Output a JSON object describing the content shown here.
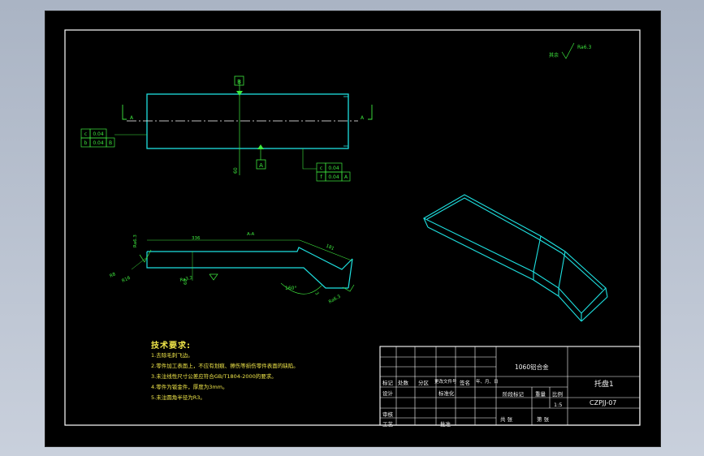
{
  "colors": {
    "outline": "#1ee0e0",
    "dimension": "#3ee83e",
    "text": "#f0e64a",
    "frame": "#ffffff",
    "background": "#000000"
  },
  "front_view": {
    "datum_top": "B",
    "datum_bottom": "A",
    "dim_vertical": "60",
    "section_left": "A",
    "section_right": "A",
    "fcf_left": [
      {
        "sym": "c",
        "val": "0.04"
      },
      {
        "sym": "b",
        "val": "0.04",
        "ref": "B"
      }
    ],
    "fcf_right": [
      {
        "sym": "c",
        "val": "0.04"
      },
      {
        "sym": "f",
        "val": "0.04",
        "ref": "A"
      }
    ]
  },
  "section_view": {
    "title": "A-A",
    "dim_length": "336",
    "dim_slope_len": "181",
    "angle": "160°",
    "dim_r1": "R8",
    "dim_r2": "R16",
    "dim_thk": "3",
    "dim_side": "60",
    "rough_top": "Ra6.3",
    "rough_bottom": "Ra3.2",
    "rough_end": "Ra6.3"
  },
  "roughness_note": {
    "prefix": "其余",
    "value": "Ra6.3"
  },
  "tech_req": {
    "title": "技术要求:",
    "lines": [
      "1.去除毛刺飞边。",
      "2.零件加工表面上，不应有划痕、擦伤等损伤零件表面的缺陷。",
      "3.未注线性尺寸公差应符合GB/T1804-2000的要求。",
      "4.零件为钣金件，厚度为3mm。",
      "5.未注圆角半径为R3。"
    ]
  },
  "title_block": {
    "material": "1060铝合金",
    "part_name": "托盘1",
    "drawing_no": "CZPJJ-07",
    "header_cells": [
      "标记",
      "处数",
      "分区",
      "更改文件号",
      "签名",
      "年、月、日"
    ],
    "design": "设计",
    "standard": "标准化",
    "check": "审核",
    "process": "工艺",
    "approve": "批准",
    "stage_mark": "阶段标记",
    "weight": "重量",
    "scale_label": "比例",
    "scale": "1:5",
    "sheets_total": "共 张",
    "sheet_no": "第 张"
  }
}
